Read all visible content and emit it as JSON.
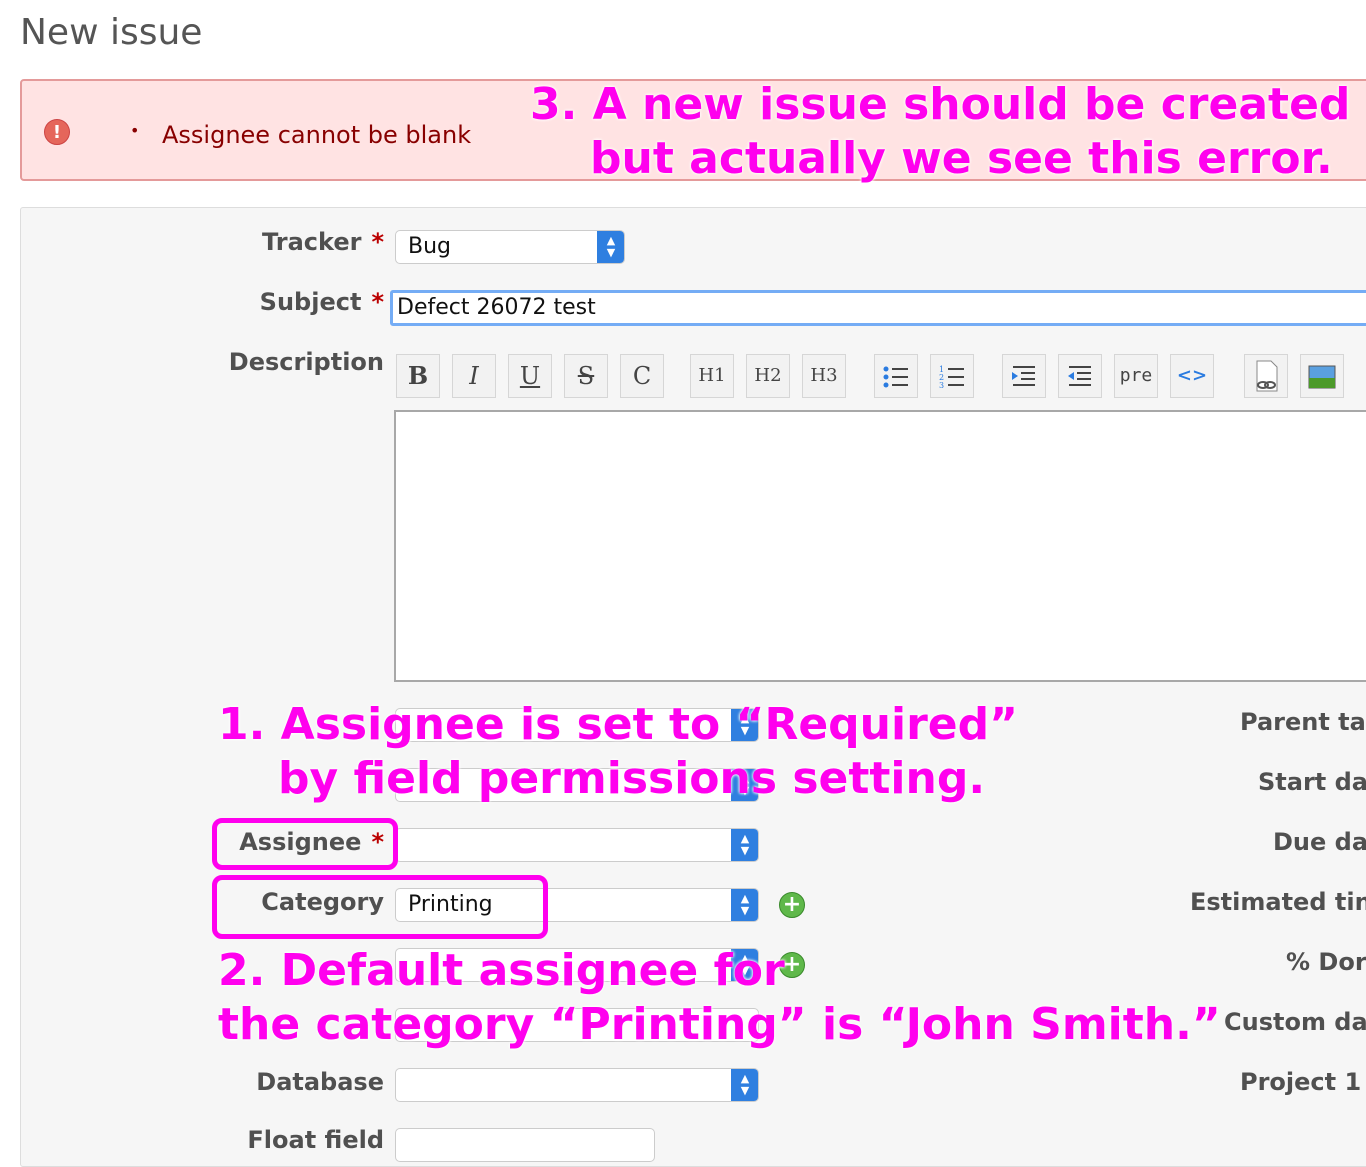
{
  "page": {
    "title": "New issue"
  },
  "flash": {
    "bullet": "•",
    "message": "Assignee cannot be blank",
    "icon": "error-icon"
  },
  "form": {
    "tracker": {
      "label": "Tracker",
      "value": "Bug",
      "required": "*"
    },
    "subject": {
      "label": "Subject",
      "value": "Defect 26072 test",
      "required": "*"
    },
    "description": {
      "label": "Description"
    },
    "toolbar": [
      "B",
      "I",
      "U",
      "S",
      "C",
      "H1",
      "H2",
      "H3",
      "ul",
      "ol",
      "indent",
      "outdent",
      "pre",
      "<>",
      "link-file",
      "image"
    ],
    "assignee": {
      "label": "Assignee",
      "value": "",
      "required": "*"
    },
    "category": {
      "label": "Category",
      "value": "Printing"
    },
    "database": {
      "label": "Database",
      "value": ""
    },
    "float_field": {
      "label": "Float field"
    },
    "right_labels": [
      "Parent ta",
      "Start da",
      "Due da",
      "Estimated tin",
      "% Dor",
      "Custom da",
      "Project 1"
    ]
  },
  "annotations": {
    "note1_line1": "1. Assignee is set to “Required”",
    "note1_line2": "by field permissions setting.",
    "note2_line1": "2. Default assignee for",
    "note2_line2": "the category “Printing” is “John Smith.”",
    "note3_line1": "3. A new issue should be created",
    "note3_line2": "but actually we see this error."
  },
  "colors": {
    "annotation": "#ff00ee",
    "flash_bg": "#ffe3e3",
    "select_arrow": "#2f7fe0"
  }
}
